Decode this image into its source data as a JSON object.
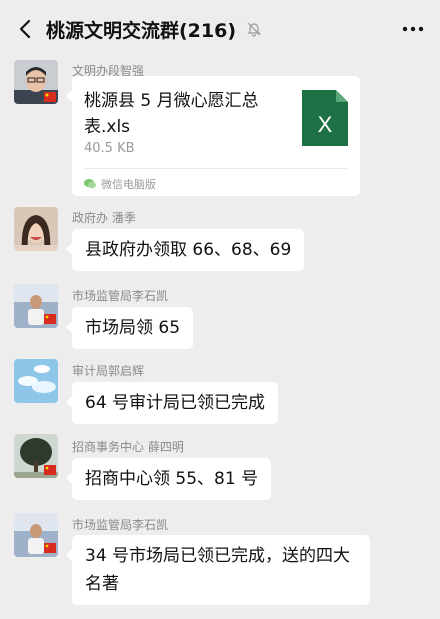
{
  "header": {
    "title": "桃源文明交流群(216)",
    "back_icon": "back-arrow-icon",
    "mute_icon": "bell-muted-icon",
    "more_icon": "more-dots-icon"
  },
  "messages": [
    {
      "sender": "文明办段智强",
      "type": "file",
      "file_name": "桃源县 5 月微心愿汇总表.xls",
      "file_size": "40.5 KB",
      "source": "微信电脑版",
      "file_icon": "excel-icon"
    },
    {
      "sender": "政府办 潘季",
      "type": "text",
      "text": "县政府办领取 66、68、69"
    },
    {
      "sender": "市场监管局李石凯",
      "type": "text",
      "text": "市场局领 65"
    },
    {
      "sender": "审计局郭启辉",
      "type": "text",
      "text": "64 号审计局已领已完成"
    },
    {
      "sender": "招商事务中心 薛四明",
      "type": "text",
      "text": "招商中心领 55、81 号"
    },
    {
      "sender": "市场监管局李石凯",
      "type": "text",
      "text_line1": "34 号市场局已领已完成，送的四大",
      "text_line2": "名著"
    }
  ],
  "colors": {
    "background": "#ededed",
    "bubble": "#ffffff",
    "excel_green": "#1e7145"
  }
}
